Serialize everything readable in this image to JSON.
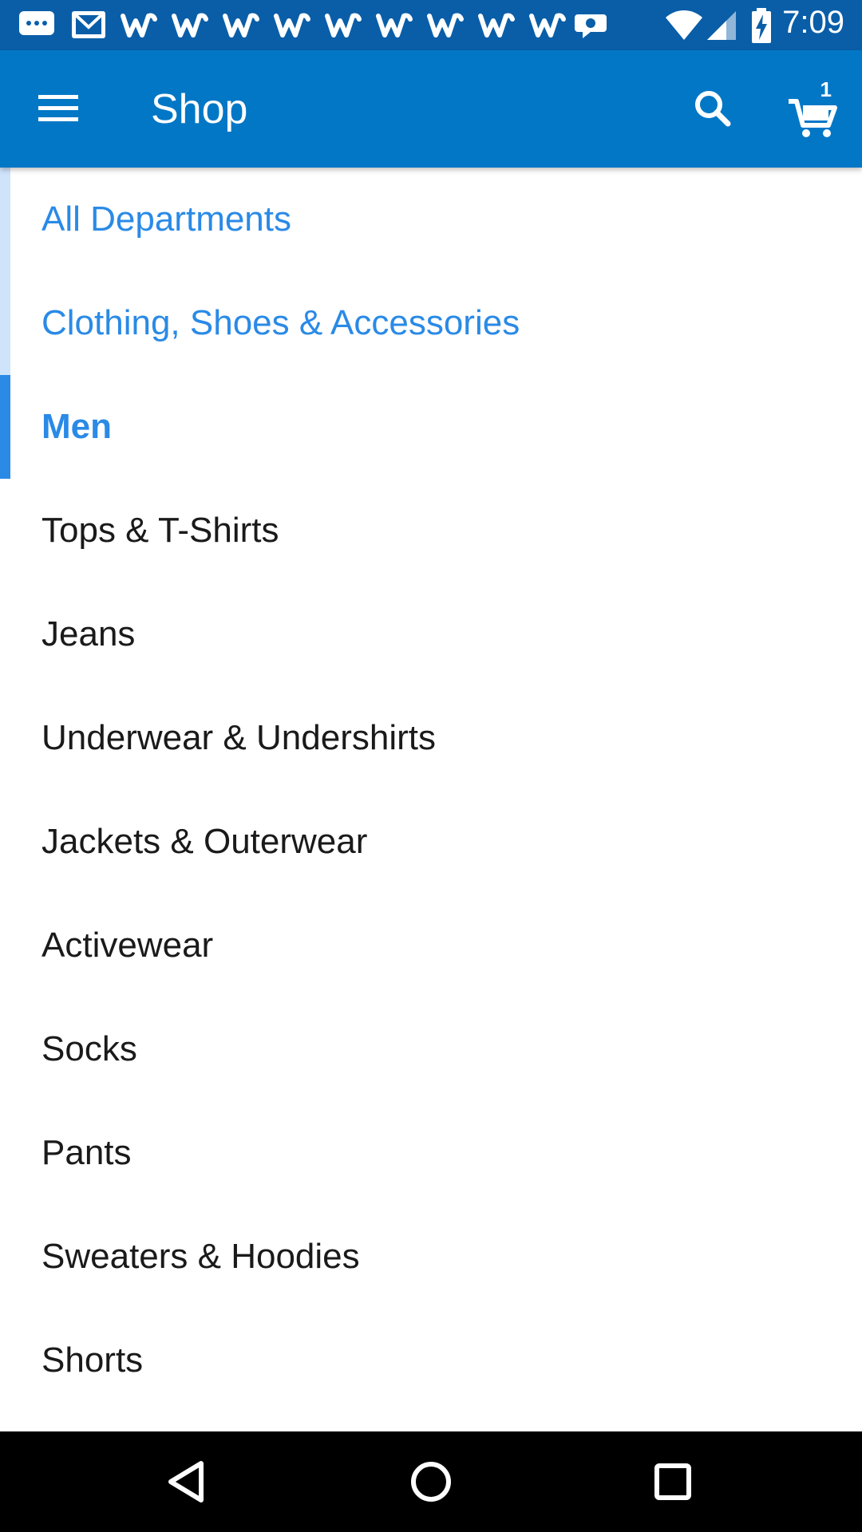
{
  "status_bar": {
    "time": "7:09",
    "icons": [
      "message-icon",
      "gmail-icon",
      "walmart-w-icon",
      "walmart-w-icon",
      "walmart-w-icon",
      "walmart-w-icon",
      "walmart-w-icon",
      "walmart-w-icon",
      "walmart-w-icon",
      "walmart-w-icon",
      "walmart-w-icon",
      "walmart-spark-icon",
      "wifi-icon",
      "cell-signal-icon",
      "battery-charging-icon"
    ]
  },
  "app_bar": {
    "title": "Shop",
    "cart_count": "1",
    "color": "#0277c6"
  },
  "breadcrumbs": [
    {
      "label": "All Departments"
    },
    {
      "label": "Clothing, Shoes & Accessories"
    }
  ],
  "current_category": {
    "label": "Men"
  },
  "subcategories": [
    {
      "label": "Tops & T-Shirts"
    },
    {
      "label": "Jeans"
    },
    {
      "label": "Underwear & Undershirts"
    },
    {
      "label": "Jackets & Outerwear"
    },
    {
      "label": "Activewear"
    },
    {
      "label": "Socks"
    },
    {
      "label": "Pants"
    },
    {
      "label": "Sweaters & Hoodies"
    },
    {
      "label": "Shorts"
    }
  ],
  "colors": {
    "accent": "#2a8ae6",
    "status_bar": "#0a5ea8",
    "nav_bar": "#000000"
  },
  "nav_bar": {
    "buttons": [
      "back-icon",
      "home-icon",
      "recents-icon"
    ]
  }
}
